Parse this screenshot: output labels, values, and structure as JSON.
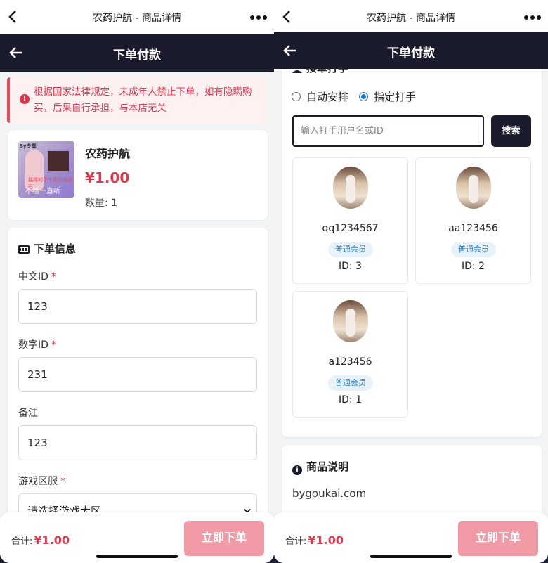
{
  "colors": {
    "navy": "#1a1c2e",
    "accent": "#e0394d",
    "button_disabled": "#f09aa6"
  },
  "miniprogram": {
    "title": "农药护航 - 商品详情"
  },
  "header": {
    "title": "下单付款"
  },
  "notice": {
    "text": "根据国家法律规定，未成年人禁止下单，如有隐瞒购买，后果自行承担，与本店无关"
  },
  "product": {
    "name": "农药护航",
    "price": "¥1.00",
    "quantity": "数量: 1",
    "image_texts": [
      "Sy专属",
      "摇摇的下午茶尔曲钻石",
      "不给一直听"
    ]
  },
  "order_info": {
    "title": "下单信息",
    "required_mark": "*",
    "fields": [
      {
        "label": "中文ID",
        "value": "123",
        "required": true
      },
      {
        "label": "数字ID",
        "value": "231",
        "required": true
      },
      {
        "label": "备注",
        "value": "123",
        "required": false
      },
      {
        "label": "游戏区服",
        "value": "请选择游戏大区",
        "required": true
      }
    ]
  },
  "booster": {
    "title": "接单打手",
    "options": [
      "自动安排",
      "指定打手"
    ],
    "selected": "指定打手",
    "search_placeholder": "输入打手用户名或ID",
    "search_button": "搜索",
    "players": [
      {
        "name": "qq1234567",
        "badge": "普通会员",
        "id": "ID: 3"
      },
      {
        "name": "aa123456",
        "badge": "普通会员",
        "id": "ID: 2"
      },
      {
        "name": "a123456",
        "badge": "普通会员",
        "id": "ID: 1"
      }
    ]
  },
  "description": {
    "title": "商品说明",
    "text": "bygoukai.com"
  },
  "footer": {
    "total_label": "合计:",
    "total_value": "¥1.00",
    "submit": "立即下单"
  },
  "icons": [
    "back-chevron-icon",
    "more-dots-icon",
    "arrow-left-icon",
    "alert-icon",
    "keyboard-icon",
    "user-icon",
    "info-icon",
    "select-chevron-icon"
  ]
}
